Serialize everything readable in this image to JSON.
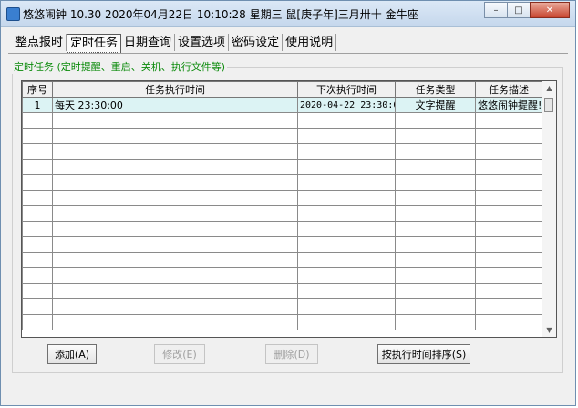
{
  "window": {
    "title": "悠悠闹钟 10.30 2020年04月22日 10:10:28 星期三 鼠[庚子年]三月卅十 金牛座",
    "minimize": "–",
    "maximize": "□",
    "close": "✕"
  },
  "tabs": [
    "整点报时",
    "定时任务",
    "日期查询",
    "设置选项",
    "密码设定",
    "使用说明"
  ],
  "group_title": "定时任务 (定时提醒、重启、关机、执行文件等)",
  "table": {
    "columns": [
      "序号",
      "任务执行时间",
      "下次执行时间",
      "任务类型",
      "任务描述"
    ],
    "rows": [
      [
        "1",
        "每天 23:30:00",
        "2020-04-22 23:30:00",
        "文字提醒",
        "悠悠闹钟提醒!"
      ]
    ]
  },
  "scrollbar": {
    "up": "▲",
    "down": "▼"
  },
  "buttons": {
    "add": "添加(A)",
    "edit": "修改(E)",
    "delete": "删除(D)",
    "sort": "按执行时间排序(S)"
  }
}
